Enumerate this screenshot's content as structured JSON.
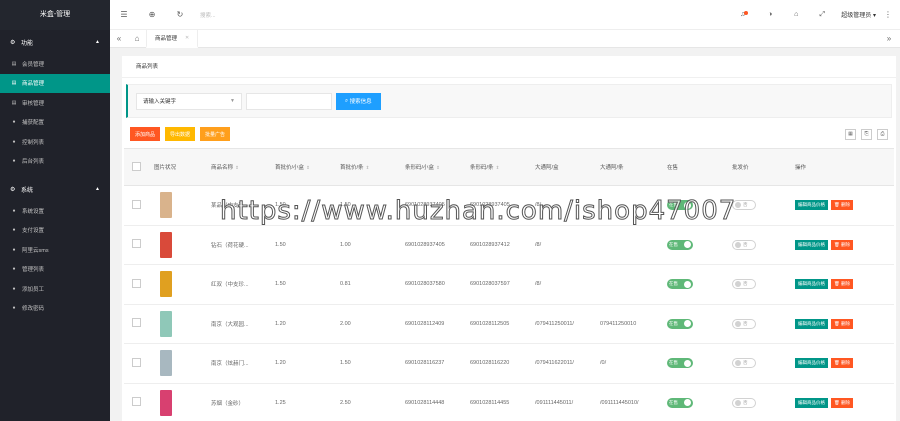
{
  "app": {
    "title": "米盒-管理"
  },
  "sidebar": {
    "groups": [
      {
        "label": "功能",
        "items": [
          {
            "label": "会员管理",
            "active": false
          },
          {
            "label": "商品管理",
            "active": true
          },
          {
            "label": "审核管理",
            "active": false
          },
          {
            "label": "捕获配置",
            "active": false
          },
          {
            "label": "控制列表",
            "active": false
          },
          {
            "label": "后台列表",
            "active": false
          }
        ]
      },
      {
        "label": "系统",
        "items": [
          {
            "label": "系统设置",
            "active": false
          },
          {
            "label": "支付设置",
            "active": false
          },
          {
            "label": "阿里云sms",
            "active": false
          },
          {
            "label": "管理列表",
            "active": false
          },
          {
            "label": "添加员工",
            "active": false
          },
          {
            "label": "修改密码",
            "active": false
          }
        ]
      }
    ]
  },
  "header": {
    "search_placeholder": "搜索...",
    "user": "超级管理员"
  },
  "tabs": [
    {
      "label": "商品管理"
    }
  ],
  "card": {
    "title": "商品列表"
  },
  "search": {
    "select_value": "请输入关键字",
    "button_label": "搜索信息"
  },
  "toolbar": {
    "btn1": "添加商品",
    "btn2": "导出数据",
    "btn3": "批量广告"
  },
  "table": {
    "headers": [
      "图片状况",
      "商品名称",
      "首批价/小盒",
      "首批价/条",
      "条形码/小盒",
      "条形码/条",
      "大通阿/盒",
      "大通阿/条",
      "在售",
      "批发价",
      "操作"
    ],
    "rows": [
      {
        "name": "某品（中支）",
        "price_box": "1.50",
        "price_strip": "1.50",
        "barcode_box": "6901028937405",
        "barcode_strip": "6901028937405",
        "link_box": "/8/",
        "link_strip": "",
        "sale": "在售",
        "wholesale": "否",
        "thumb": "#d9b38c"
      },
      {
        "name": "钻石（荷花硬...",
        "price_box": "1.50",
        "price_strip": "1.00",
        "barcode_box": "6901028937405",
        "barcode_strip": "6901028937412",
        "link_box": "/8/",
        "link_strip": "",
        "sale": "在售",
        "wholesale": "否",
        "thumb": "#d94a3a"
      },
      {
        "name": "红双（中支珍...",
        "price_box": "1.50",
        "price_strip": "0.81",
        "barcode_box": "6901028037580",
        "barcode_strip": "6901028037597",
        "link_box": "/8/",
        "link_strip": "",
        "sale": "在售",
        "wholesale": "否",
        "thumb": "#e0a020"
      },
      {
        "name": "南京（大观园...",
        "price_box": "1.20",
        "price_strip": "2.00",
        "barcode_box": "6901028112409",
        "barcode_strip": "6901028112505",
        "link_box": "/079411250011/",
        "link_strip": "079411250010",
        "sale": "在售",
        "wholesale": "否",
        "thumb": "#8fc8b8"
      },
      {
        "name": "南京（炫赫门...",
        "price_box": "1.20",
        "price_strip": "1.50",
        "barcode_box": "6901028116237",
        "barcode_strip": "6901028116220",
        "link_box": "/079411622011/",
        "link_strip": "/0/",
        "sale": "在售",
        "wholesale": "否",
        "thumb": "#a8b8c0"
      },
      {
        "name": "苏烟（金砂）",
        "price_box": "1.25",
        "price_strip": "2.50",
        "barcode_box": "6901028114448",
        "barcode_strip": "6901028114455",
        "link_box": "/091111445011/",
        "link_strip": "/091111445010/",
        "sale": "在售",
        "wholesale": "否",
        "thumb": "#d84070"
      }
    ],
    "action_edit": "编辑商品价格",
    "action_delete": "删除"
  },
  "watermark": "https://www.huzhan.com/ishop47007"
}
